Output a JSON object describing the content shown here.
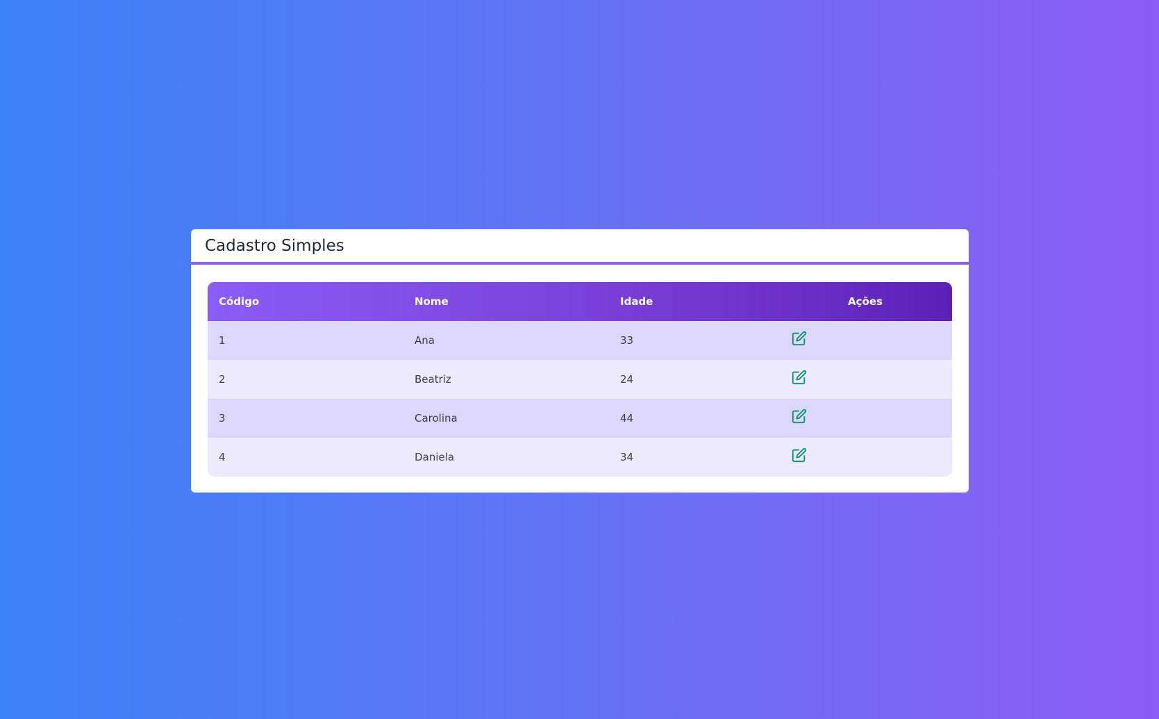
{
  "card": {
    "title": "Cadastro Simples"
  },
  "table": {
    "headers": {
      "codigo": "Código",
      "nome": "Nome",
      "idade": "Idade",
      "acoes": "Ações"
    },
    "rows": [
      {
        "codigo": "1",
        "nome": "Ana",
        "idade": "33",
        "action_icon": "edit-icon"
      },
      {
        "codigo": "2",
        "nome": "Beatriz",
        "idade": "24",
        "action_icon": "edit-icon"
      },
      {
        "codigo": "3",
        "nome": "Carolina",
        "idade": "44",
        "action_icon": "edit-icon"
      },
      {
        "codigo": "4",
        "nome": "Daniela",
        "idade": "34",
        "action_icon": "edit-icon"
      }
    ]
  },
  "colors": {
    "background_start": "#3b82f6",
    "background_end": "#8b5cf6",
    "accent": "#8b5cf6",
    "header_gradient_end": "#5b21b6",
    "row_odd": "#ddd6fe",
    "row_even": "#ede9fe",
    "edit_icon": "#059669"
  }
}
